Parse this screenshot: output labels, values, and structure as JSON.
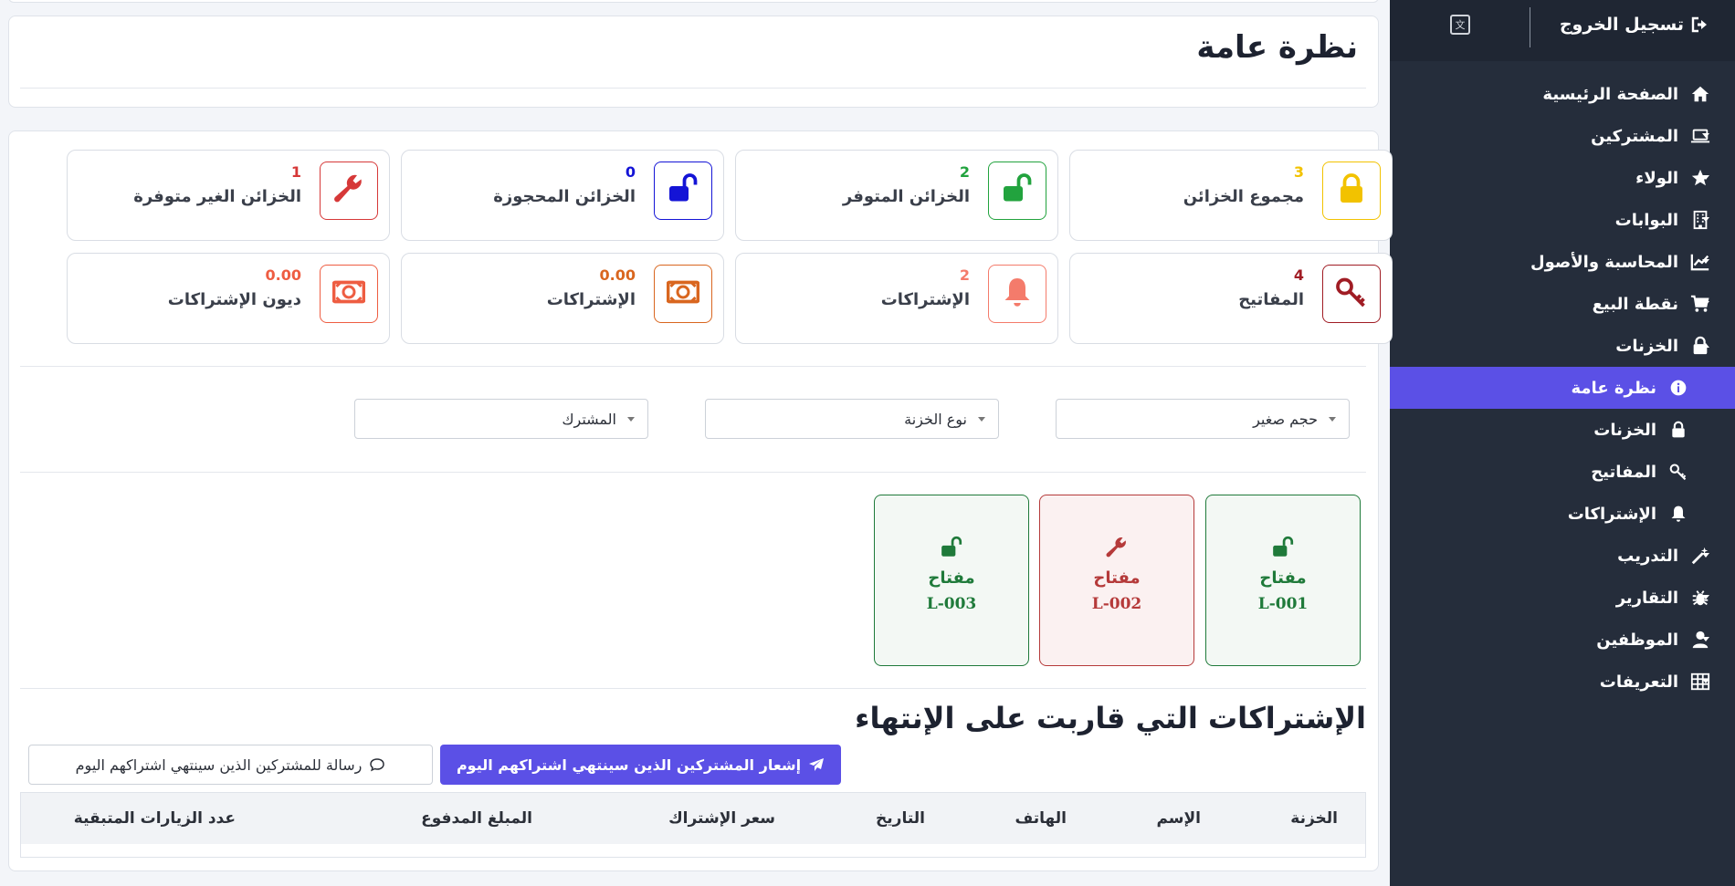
{
  "sidebar": {
    "logout_label": "تسجيل الخروج",
    "items": [
      {
        "label": "الصفحة الرئيسية",
        "icon": "home-icon",
        "has_caret": false
      },
      {
        "label": "المشتركين",
        "icon": "laptop-icon",
        "has_caret": true
      },
      {
        "label": "الولاء",
        "icon": "star-icon",
        "has_caret": true
      },
      {
        "label": "البوابات",
        "icon": "building-icon",
        "has_caret": true
      },
      {
        "label": "المحاسبة والأصول",
        "icon": "chart-line-icon",
        "has_caret": true
      },
      {
        "label": "نقطة البيع",
        "icon": "cart-icon",
        "has_caret": true
      },
      {
        "label": "الخزنات",
        "icon": "lock-icon",
        "has_caret": true,
        "expanded": true
      },
      {
        "label": "نظرة عامة",
        "icon": "info-icon",
        "sub": true,
        "active": true
      },
      {
        "label": "الخزنات",
        "icon": "lock-icon",
        "sub": true
      },
      {
        "label": "المفاتيح",
        "icon": "key-icon",
        "sub": true
      },
      {
        "label": "الإشتراكات",
        "icon": "bell-icon",
        "sub": true
      },
      {
        "label": "التدريب",
        "icon": "wand-icon",
        "has_caret": true
      },
      {
        "label": "التقارير",
        "icon": "bug-icon",
        "has_caret": true
      },
      {
        "label": "الموظفين",
        "icon": "user-icon",
        "has_caret": true
      },
      {
        "label": "التعريفات",
        "icon": "table-icon",
        "has_caret": true
      }
    ]
  },
  "header": {
    "title": "نظرة عامة"
  },
  "stats": [
    {
      "value": "3",
      "label": "مجموع الخزائن",
      "icon": "lock-icon",
      "color": "#f2c200"
    },
    {
      "value": "2",
      "label": "الخزائن المتوفر",
      "icon": "unlock-icon",
      "color": "#22a33e"
    },
    {
      "value": "0",
      "label": "الخزائن المحجوزة",
      "icon": "unlock-icon",
      "color": "#1414d6"
    },
    {
      "value": "1",
      "label": "الخزائن الغير متوفرة",
      "icon": "wrench-icon",
      "color": "#d63838"
    },
    {
      "value": "4",
      "label": "المفاتيح",
      "icon": "key-icon",
      "color": "#a01c24"
    },
    {
      "value": "2",
      "label": "الإشتراكات",
      "icon": "bell-icon",
      "color": "#f47b6b"
    },
    {
      "value": "0.00",
      "label": "الإشتراكات",
      "icon": "money-icon",
      "color": "#d9661f"
    },
    {
      "value": "0.00",
      "label": "ديون الإشتراكات",
      "icon": "money-icon",
      "color": "#ee5d42"
    }
  ],
  "filters": [
    {
      "value": "حجم صغير"
    },
    {
      "value": "نوع الخزنة"
    },
    {
      "value": "المشترك"
    }
  ],
  "keys": [
    {
      "name": "مفتاح",
      "code": "L-001",
      "status": "green",
      "icon": "unlock-icon"
    },
    {
      "name": "مفتاح",
      "code": "L-002",
      "status": "red",
      "icon": "wrench-icon"
    },
    {
      "name": "مفتاح",
      "code": "L-003",
      "status": "green",
      "icon": "unlock-icon"
    }
  ],
  "expiring": {
    "title": "الإشتراكات التي قاربت على الإنتهاء",
    "notify_button": "إشعار المشتركين الذين سينتهي اشتراكهم اليوم",
    "message_button": "رسالة للمشتركين الذين سينتهي اشتراكهم اليوم",
    "columns": [
      "الخزنة",
      "الإسم",
      "الهاتف",
      "التاريخ",
      "سعر الإشتراك",
      "المبلغ المدفوع",
      "عدد الزيارات المتبقية"
    ]
  }
}
